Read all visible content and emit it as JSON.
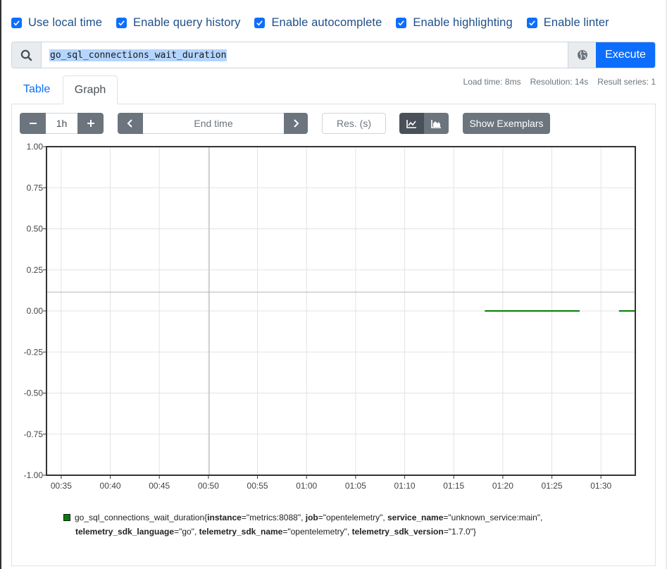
{
  "options": [
    {
      "label": "Use local time",
      "checked": true
    },
    {
      "label": "Enable query history",
      "checked": true
    },
    {
      "label": "Enable autocomplete",
      "checked": true
    },
    {
      "label": "Enable highlighting",
      "checked": true
    },
    {
      "label": "Enable linter",
      "checked": true
    }
  ],
  "query": {
    "expression": "go_sql_connections_wait_duration",
    "execute_label": "Execute",
    "search_icon": "search-icon",
    "globe_icon": "metrics-explorer-icon"
  },
  "tabs": {
    "table": "Table",
    "graph": "Graph",
    "active": "Graph"
  },
  "stats": {
    "load_time": "Load time: 8ms",
    "resolution": "Resolution: 14s",
    "result_series": "Result series: 1"
  },
  "controls": {
    "range_decrease": "−",
    "range_value": "1h",
    "range_increase": "+",
    "end_time_placeholder": "End time",
    "resolution_placeholder": "Res. (s)",
    "stacked_off_icon": "line-chart-icon",
    "stacked_on_icon": "area-chart-icon",
    "show_exemplars": "Show Exemplars"
  },
  "chart_data": {
    "type": "line",
    "yticks": [
      "1.00",
      "0.75",
      "0.50",
      "0.25",
      "0.00",
      "-0.25",
      "-0.50",
      "-0.75",
      "-1.00"
    ],
    "xticks": [
      "00:35",
      "00:40",
      "00:45",
      "00:50",
      "00:55",
      "01:00",
      "01:05",
      "01:10",
      "01:15",
      "01:20",
      "01:25",
      "01:30"
    ],
    "ylim": [
      -1,
      1
    ],
    "xlim": [
      "00:33:30",
      "01:33:30"
    ],
    "grid": true,
    "series": [
      {
        "name": "go_sql_connections_wait_duration",
        "color": "#008000",
        "segments": [
          [
            {
              "x": "01:18:10",
              "y": 0
            },
            {
              "x": "01:27:50",
              "y": 0
            }
          ],
          [
            {
              "x": "01:31:50",
              "y": 0
            },
            {
              "x": "01:33:30",
              "y": 0
            }
          ]
        ]
      }
    ],
    "crosshair": {
      "x": "00:50:05",
      "y": 0.115
    }
  },
  "legend": {
    "metric": "go_sql_connections_wait_duration",
    "labels": [
      {
        "key": "instance",
        "value": "\"metrics:8088\""
      },
      {
        "key": "job",
        "value": "\"opentelemetry\""
      },
      {
        "key": "service_name",
        "value": "\"unknown_service:main\""
      },
      {
        "key": "telemetry_sdk_language",
        "value": "\"go\""
      },
      {
        "key": "telemetry_sdk_name",
        "value": "\"opentelemetry\""
      },
      {
        "key": "telemetry_sdk_version",
        "value": "\"1.7.0\""
      }
    ]
  }
}
